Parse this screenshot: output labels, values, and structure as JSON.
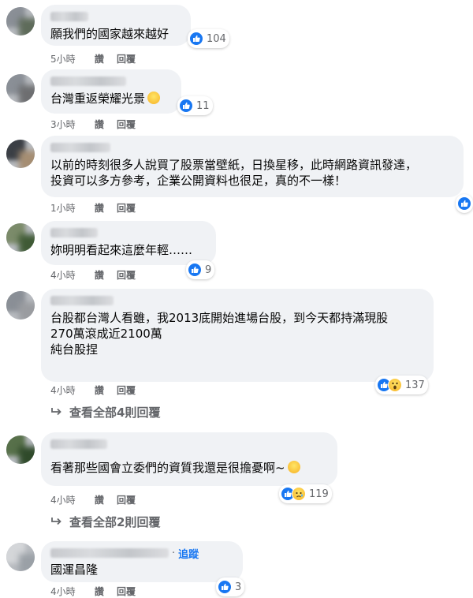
{
  "comments": [
    {
      "text": "願我們的國家越來越好",
      "reactions": {
        "icons": [
          "like-icon"
        ],
        "count": "104"
      },
      "time": "5小時",
      "like_label": "讚",
      "reply_label": "回覆"
    },
    {
      "text": "台灣重返榮耀光景",
      "reactions": {
        "icons": [
          "like-icon"
        ],
        "count": "11"
      },
      "time": "3小時",
      "like_label": "讚",
      "reply_label": "回覆"
    },
    {
      "text": "以前的時刻很多人說買了股票當壁紙，日換星移，此時網路資訊發達，\n投資可以多方參考，企業公開資料也很足，真的不一樣！",
      "reactions": {
        "icons": [
          "like-icon"
        ],
        "count": ""
      },
      "time": "1小時",
      "like_label": "讚",
      "reply_label": "回覆"
    },
    {
      "text": "妳明明看起來這麼年輕……",
      "reactions": {
        "icons": [
          "like-icon"
        ],
        "count": "9"
      },
      "time": "4小時",
      "like_label": "讚",
      "reply_label": "回覆"
    },
    {
      "text": "台股都台灣人看雖，我2013底開始進場台股，到今天都持滿現股\n270萬滾成近2100萬\n純台股捏",
      "reactions": {
        "icons": [
          "like-icon",
          "wow-icon"
        ],
        "count": "137"
      },
      "time": "4小時",
      "like_label": "讚",
      "reply_label": "回覆",
      "view_replies": "查看全部4則回覆"
    },
    {
      "text": "看著那些國會立委們的資質我還是很擔憂啊~",
      "reactions": {
        "icons": [
          "like-icon",
          "sad-icon"
        ],
        "count": "119"
      },
      "time": "4小時",
      "like_label": "讚",
      "reply_label": "回覆",
      "view_replies": "查看全部2則回覆"
    },
    {
      "text": "國運昌隆",
      "follow_label": "追蹤",
      "reactions": {
        "icons": [
          "like-icon"
        ],
        "count": "3"
      },
      "time": "4小時",
      "like_label": "讚",
      "reply_label": "回覆"
    }
  ],
  "colors": {
    "like": "#1877f2",
    "bubble": "#f0f2f5",
    "meta": "#65676b"
  }
}
